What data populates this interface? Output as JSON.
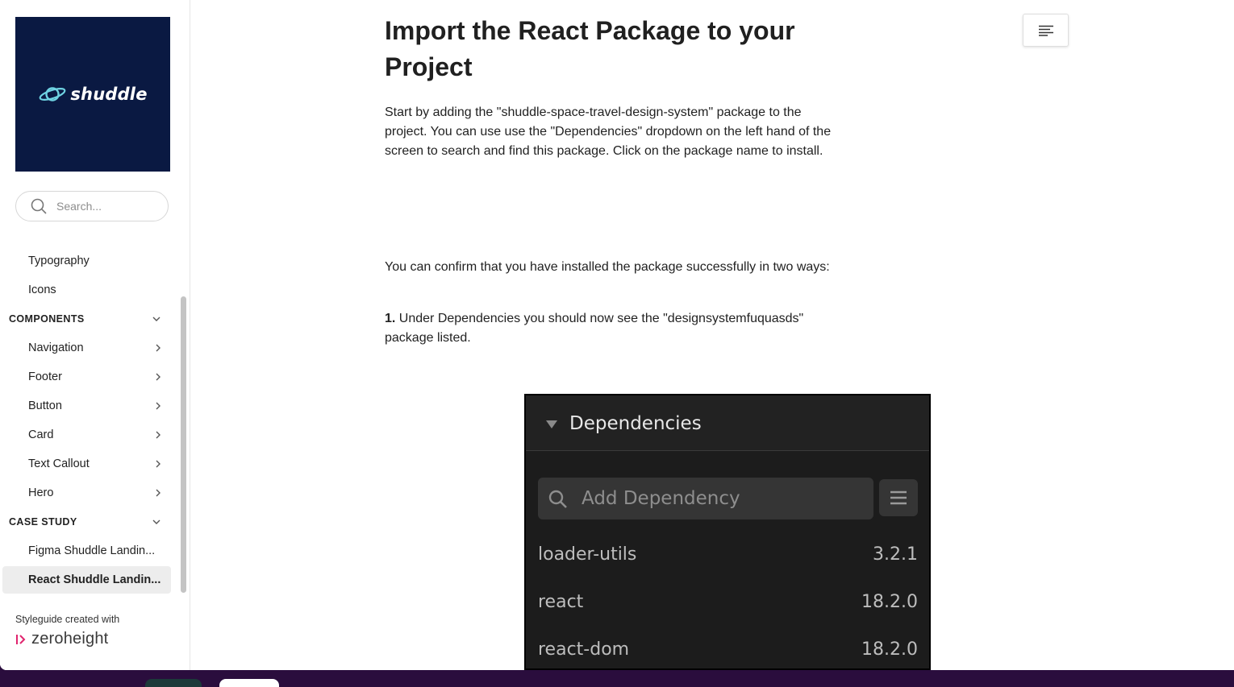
{
  "sidebar": {
    "logo_text": "shuddle",
    "search_placeholder": "Search...",
    "items": [
      {
        "label": "Typography"
      },
      {
        "label": "Icons"
      }
    ],
    "sections": [
      {
        "label": "COMPONENTS",
        "items": [
          {
            "label": "Navigation"
          },
          {
            "label": "Footer"
          },
          {
            "label": "Button"
          },
          {
            "label": "Card"
          },
          {
            "label": "Text Callout"
          },
          {
            "label": "Hero"
          }
        ]
      },
      {
        "label": "CASE STUDY",
        "items": [
          {
            "label": "Figma Shuddle Landin..."
          },
          {
            "label": "React Shuddle Landin...",
            "active": true
          }
        ]
      }
    ],
    "credit_label": "Styleguide created with",
    "credit_brand": "zeroheight"
  },
  "main": {
    "title": "Import the React Package to your Project",
    "intro": "Start by adding the \"shuddle-space-travel-design-system\" package to the project. You can use use the \"Dependencies\" dropdown on the left hand of the screen to search and find this package. Click on the package name to install.",
    "confirm": "You can confirm that you have installed the package successfully in two ways:",
    "step1_number": "1.",
    "step1_text": " Under Dependencies you should now see the \"designsystemfuquasds\" package listed."
  },
  "dependencies_image": {
    "title": "Dependencies",
    "search_placeholder": "Add Dependency",
    "rows": [
      {
        "name": "loader-utils",
        "version": "3.2.1"
      },
      {
        "name": "react",
        "version": "18.2.0"
      },
      {
        "name": "react-dom",
        "version": "18.2.0"
      }
    ]
  },
  "colors": {
    "logo_bg": "#0a1942",
    "zeroheight_accent": "#e0246e",
    "dark_panel": "#1c1c1c"
  }
}
